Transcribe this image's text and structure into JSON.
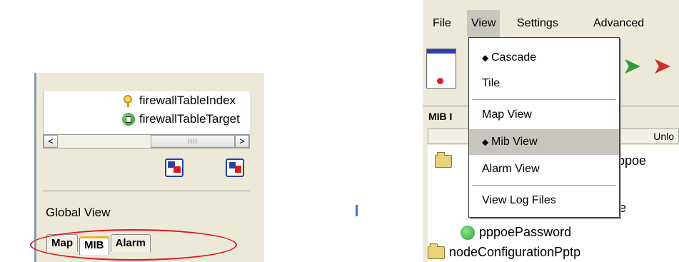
{
  "left_panel": {
    "tree_items": [
      {
        "label": "firewallTableIndex",
        "icon": "key-icon"
      },
      {
        "label": "firewallTableTarget",
        "icon": "target-icon"
      }
    ],
    "scroll_left": "<",
    "scroll_right": ">",
    "scroll_grip": "IIII",
    "global_view_label": "Global View",
    "tabs": [
      {
        "label": "Map",
        "active": false
      },
      {
        "label": "MIB",
        "active": true
      },
      {
        "label": "Alarm",
        "active": false
      }
    ],
    "highlight_color": "#e01515"
  },
  "right_panel": {
    "menu": [
      "File",
      "View",
      "Settings",
      "Advanced"
    ],
    "active_menu": "View",
    "view_menu_items": [
      {
        "label": "Cascade",
        "bullet": "◆"
      },
      {
        "label": "Tile",
        "bullet": ""
      },
      {
        "label": "Map View",
        "bullet": ""
      },
      {
        "label": "Mib View",
        "bullet": "◆",
        "selected": true
      },
      {
        "label": "Alarm View",
        "bullet": ""
      },
      {
        "label": "View Log Files",
        "bullet": ""
      }
    ],
    "mib_label": "MIB I",
    "column_header": "Unlo",
    "tree_items": [
      {
        "label": "pppoe",
        "icon": "folder-icon"
      },
      {
        "label": "e",
        "icon": ""
      },
      {
        "label": "pppoePassword",
        "icon": "leaf-icon"
      },
      {
        "label": "nodeConfigurationPptp",
        "icon": "folder-icon"
      }
    ]
  }
}
